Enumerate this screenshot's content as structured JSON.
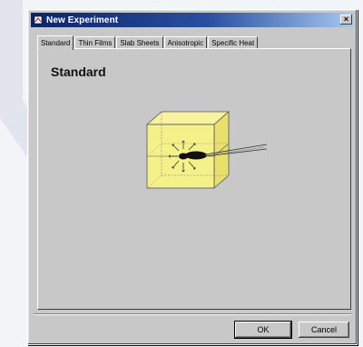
{
  "window": {
    "title": "New Experiment",
    "close_label": "×"
  },
  "tabs": [
    {
      "label": "Standard",
      "active": true
    },
    {
      "label": "Thin Films",
      "active": false
    },
    {
      "label": "Slab Sheets",
      "active": false
    },
    {
      "label": "Anisotropic",
      "active": false
    },
    {
      "label": "Specific Heat",
      "active": false
    }
  ],
  "panel": {
    "title": "Standard",
    "illustration": "cube-sample-with-probe-icon"
  },
  "buttons": {
    "ok_label": "OK",
    "cancel_label": "Cancel"
  },
  "colors": {
    "titlebar_start": "#0a246a",
    "titlebar_end": "#a6caf0",
    "dialog_face": "#c8c8c8",
    "cube_fill": "#f4f08a"
  }
}
